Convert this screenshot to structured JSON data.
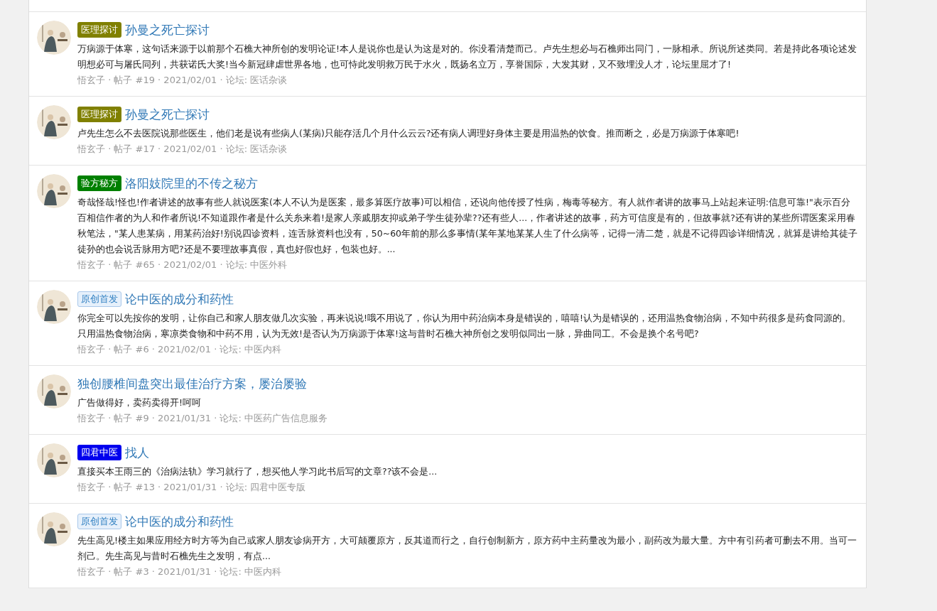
{
  "posts": [
    {
      "tag": {
        "label": "医理探讨",
        "kind": "filled",
        "color": "#808000"
      },
      "title": "孙曼之死亡探讨",
      "excerpt": "万病源于体寒，这句话来源于以前那个石樵大神所创的发明论证!本人是说你也是认为这是对的。你没看清楚而己。卢先生想必与石樵师出同门，一脉相承。所说所述类同。若是持此各项论述发明想必可与屠氏同列，共获诺氏大奖!当今新冠肆虐世界各地，也可恃此发明救万民于水火，既扬名立万，享誉国际，大发其财，又不致埋没人才，论坛里屈才了!",
      "meta": "悟玄子 · 帖子 #19 · 2021/02/01 · 论坛: 医话杂谈"
    },
    {
      "tag": {
        "label": "医理探讨",
        "kind": "filled",
        "color": "#808000"
      },
      "title": "孙曼之死亡探讨",
      "excerpt": "卢先生怎么不去医院说那些医生，他们老是说有些病人(某病)只能存活几个月什么云云?还有病人调理好身体主要是用温热的饮食。推而断之，必是万病源于体寒吧!",
      "meta": "悟玄子 · 帖子 #17 · 2021/02/01 · 论坛: 医话杂谈"
    },
    {
      "tag": {
        "label": "验方秘方",
        "kind": "filled",
        "color": "#008000"
      },
      "title": "洛阳妓院里的不传之秘方",
      "excerpt": "奇哉怪哉!怪也!作者讲述的故事有些人就说医案(本人不认为是医案，最多算医疗故事)可以相信，还说向他传授了性病，梅毒等秘方。有人就作者讲的故事马上站起来证明:信息可靠!\"表示百分百相信作者的为人和作者所说!不知道跟作者是什么关糸来着!是家人亲戚朋友抑或弟子学生徒孙辈??还有些人...，作者讲述的故事，药方可信度是有的，但故事就?还有讲的某些所谓医案采用春秋笔法，\"某人患某病，用某药治好!别说四诊资料，连舌脉资料也没有，50~60年前的那么多事情(某年某地某某人生了什么病等，记得一清二楚，就是不记得四诊详细情况，就算是讲给其徒子徒孙的也会说舌脉用方吧?还是不要理故事真假，真也好假也好，包装也好。...",
      "meta": "悟玄子 · 帖子 #65 · 2021/02/01 · 论坛: 中医外科"
    },
    {
      "tag": {
        "label": "原创首发",
        "kind": "outline",
        "color": "#2f7fc1"
      },
      "title": "论中医的成分和药性",
      "excerpt": "你完全可以先按你的发明，让你自己和家人朋友做几次实验，再来说说!哦不用说了，你认为用中药治病本身是错误的，嘻嘻!认为是错误的，还用温热食物治病，不知中药很多是药食同源的。只用温热食物治病，寒凉类食物和中药不用，认为无效!是否认为万病源于体寒!这与昔时石樵大神所创之发明似同出一脉，异曲同工。不会是换个名号吧?",
      "meta": "悟玄子 · 帖子 #6 · 2021/02/01 · 论坛: 中医内科"
    },
    {
      "title": "独创腰椎间盘突出最佳治疗方案，屡治屡验",
      "excerpt": "广告做得好，卖药卖得开!呵呵",
      "meta": "悟玄子 · 帖子 #9 · 2021/01/31 · 论坛: 中医药广告信息服务"
    },
    {
      "tag": {
        "label": "四君中医",
        "kind": "filled",
        "color": "#0000ee"
      },
      "title": "找人",
      "excerpt": "直接买本王雨三的《治病法轨》学习就行了，想买他人学习此书后写的文章??该不会是...",
      "meta": "悟玄子 · 帖子 #13 · 2021/01/31 · 论坛: 四君中医专版"
    },
    {
      "tag": {
        "label": "原创首发",
        "kind": "outline",
        "color": "#2f7fc1"
      },
      "title": "论中医的成分和药性",
      "excerpt": "先生高见!楼主如果应用经方时方等为自己或家人朋友诊病开方，大可颠覆原方，反其道而行之，自行创制新方，原方药中主药量改为最小，副药改为最大量。方中有引药者可删去不用。当可一剂己。先生高见与昔时石樵先生之发明，有点...",
      "meta": "悟玄子 · 帖子 #3 · 2021/01/31 · 论坛: 中医内科"
    }
  ]
}
